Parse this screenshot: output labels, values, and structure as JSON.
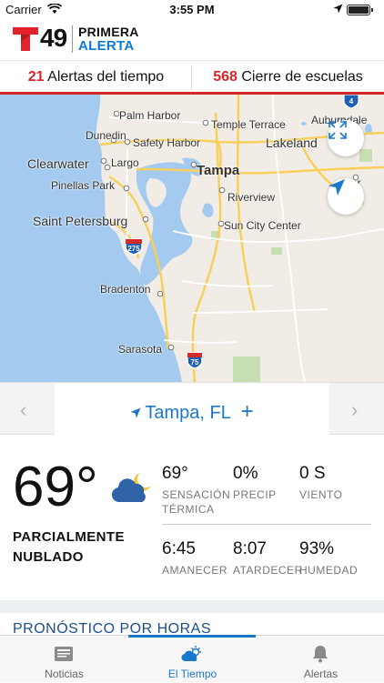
{
  "status_bar": {
    "carrier": "Carrier",
    "time": "3:55 PM"
  },
  "header": {
    "logo_number": "49",
    "logo_line1": "PRIMERA",
    "logo_line2": "ALERTA"
  },
  "alerts": {
    "weather_count": "21",
    "weather_label": "Alertas del tiempo",
    "school_count": "568",
    "school_label": "Cierre de escuelas"
  },
  "map": {
    "labels": [
      "Palm Harbor",
      "Temple Terrace",
      "Auburndale",
      "Dunedin",
      "Safety Harbor",
      "Lakeland",
      "Clearwater",
      "Largo",
      "Tampa",
      "Bar",
      "Pinellas Park",
      "Riverview",
      "Saint Petersburg",
      "Sun City Center",
      "Bradenton",
      "Sarasota"
    ],
    "shields": [
      "275",
      "75",
      "4"
    ]
  },
  "location": {
    "city": "Tampa, FL",
    "add": "+",
    "prev": "‹",
    "next": "›"
  },
  "current": {
    "temperature": "69°",
    "condition": "PARCIALMENTE NUBLADO",
    "feels_like_value": "69°",
    "feels_like_label": "SENSACIÓN TÉRMICA",
    "precip_value": "0%",
    "precip_label": "PRECIP",
    "wind_value": "0 S",
    "wind_label": "VIENTO",
    "sunrise_value": "6:45",
    "sunrise_label": "AMANECER",
    "sunset_value": "8:07",
    "sunset_label": "ATARDECER",
    "humidity_value": "93%",
    "humidity_label": "HUMEDAD"
  },
  "hourly": {
    "title": "PRONÓSTICO POR HORAS"
  },
  "tabs": [
    {
      "label": "Noticias",
      "icon": "news-icon"
    },
    {
      "label": "El Tiempo",
      "icon": "weather-icon"
    },
    {
      "label": "Alertas",
      "icon": "bell-icon"
    }
  ],
  "colors": {
    "accent": "#1a78c9",
    "alert_red": "#d4272c",
    "logo_blue": "#0a7bd6"
  }
}
